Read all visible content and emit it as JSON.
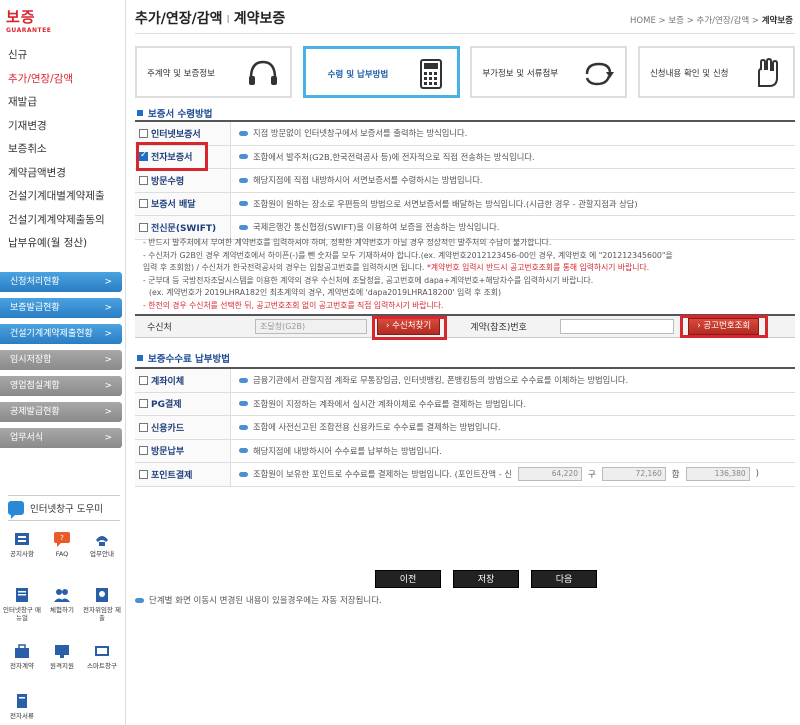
{
  "logo": {
    "title": "보증",
    "subtitle": "GUARANTEE"
  },
  "sidebar": {
    "menu": [
      "신규",
      "추가/연장/감액",
      "재발급",
      "기재변경",
      "보증취소",
      "계약금액변경",
      "건설기계대별계약제출",
      "건설기계계약제출동의",
      "납부유예(월 정산)"
    ],
    "active_index": 1,
    "section_buttons": [
      {
        "label": "신청처리현황",
        "arrow": ">",
        "style": "blue"
      },
      {
        "label": "보증발급현황",
        "arrow": ">",
        "style": "blue"
      },
      {
        "label": "건설기계계약제출현황",
        "arrow": ">",
        "style": "blue"
      },
      {
        "label": "임시저장함",
        "arrow": ">",
        "style": "gray"
      },
      {
        "label": "영업점실계함",
        "arrow": ">",
        "style": "gray"
      },
      {
        "label": "공제발급현황",
        "arrow": ">",
        "style": "gray"
      },
      {
        "label": "업무서식",
        "arrow": ">",
        "style": "gray"
      }
    ],
    "helper_title": "인터넷창구 도우미",
    "quick_links": [
      {
        "label": "공지사항",
        "icon": "notice-icon"
      },
      {
        "label": "FAQ",
        "icon": "faq-icon"
      },
      {
        "label": "업무안내",
        "icon": "phone-icon"
      },
      {
        "label": "인터넷창구 매뉴얼",
        "icon": "manual-icon"
      },
      {
        "label": "체험하기",
        "icon": "people-icon"
      },
      {
        "label": "전자위임장 제출",
        "icon": "document-icon"
      },
      {
        "label": "전자계약",
        "icon": "briefcase-icon"
      },
      {
        "label": "원격지원",
        "icon": "remote-icon"
      },
      {
        "label": "스마트창구",
        "icon": "smart-icon"
      },
      {
        "label": "전자서류",
        "icon": "paper-icon"
      }
    ]
  },
  "header": {
    "title_main": "추가/연장/감액",
    "title_sep": "I",
    "title_sub": "계약보증",
    "breadcrumb": [
      "HOME",
      ">",
      "보증",
      ">",
      "추가/연장/감액",
      ">",
      "계약보증"
    ]
  },
  "steps": [
    {
      "label": "주계약 및 보증정보",
      "icon": "headset-icon"
    },
    {
      "label": "수령 및 납부방법",
      "icon": "calculator-icon",
      "active": true
    },
    {
      "label": "부가정보 및 서류첨부",
      "icon": "rotate-icon"
    },
    {
      "label": "신청내용 확인 및 신청",
      "icon": "hand-icon"
    }
  ],
  "receipt_section": {
    "title": "보증서 수령방법",
    "options": [
      {
        "label": "인터넷보증서",
        "desc": "지점 방문없이 인터넷창구에서 보증서를 출력하는 방식입니다.",
        "checked": false
      },
      {
        "label": "전자보증서",
        "desc": "조합에서 발주처(G2B,한국전력공사 등)에 전자적으로 직접 전송하는 방식입니다.",
        "checked": true
      },
      {
        "label": "방문수령",
        "desc": "해당지점에 직접 내방하시어 서면보증서를 수령하시는 방법입니다.",
        "checked": false
      },
      {
        "label": "보증서 배달",
        "desc": "조합원이 원하는 장소로 우편등의 방법으로 서면보증서를 배달하는 방식입니다.(시급한 경우 - 관할지점과 상담)",
        "checked": false
      },
      {
        "label": "전신문(SWIFT)",
        "desc": "국제은행간 통신협정(SWIFT)을 이용하여 보증을 전송하는 방식입니다.",
        "checked": false
      }
    ]
  },
  "notes": {
    "line1": "- 반드시 발주처에서 부여한 계약번호를 입력하셔야 하며, 정확한 계약번호가 아닐 경우 정상적인 발주처의 수납이 불가합니다.",
    "line2": "- 수신처가 G2B인 경우 계약번호에서 하이픈(-)를 뺀 숫자를 모두 기재하셔야 합니다.(ex. 계약번호2012123456-00인 경우, 계약번호 에 \"201212345600\"을",
    "line3a": "입력 후 조회함) / 수신처가 한국전력공사의 경우는 입찰공고번호를 입력하시면 됩니다.",
    "line3b": "*계약번호 입력시 반드시 공고번호조회를 통해 입력하시기 바랍니다.",
    "line4": "- 군부대 등 국방전자조달시스템을 이용한 계약의 경우 수신처에 조달청을, 공고번호에 dapa+계약번호+해당차수를 입력하시기 바랍니다.",
    "line5": "(ex. 계약번호가 2019LHRA182인 최초계약의 경우, 계약번호에 'dapa2019LHRA18200' 입력 후 조회)",
    "line6": "- 한전의 경우 수신처를 선택한 뒤, 공고번호조회 없이 공고번호를 직접 입력하시기 바랍니다."
  },
  "receiver": {
    "label": "수신처",
    "value": "조달청(G2B)",
    "search_button": "수신처찾기",
    "contract_label": "계약(참조)번호",
    "contract_value": "",
    "lookup_button": "공고번호조회"
  },
  "payment_section": {
    "title": "보증수수료 납부방법",
    "options": [
      {
        "label": "계좌이체",
        "desc": "금융기관에서 관할지점 계좌로 무통장입금, 인터넷뱅킹, 폰뱅킹등의 방법으로 수수료를 이체하는 방법입니다."
      },
      {
        "label": "PG결제",
        "desc": "조합원이 지정하는 계좌에서 실시간 계좌이체로 수수료를 결제하는 방법입니다."
      },
      {
        "label": "신용카드",
        "desc": "조합에 사전신고된 조합전용 신용카드로 수수료를 결제하는 방법입니다."
      },
      {
        "label": "방문납부",
        "desc": "해당지점에 내방하시어 수수료를 납부하는 방법입니다."
      },
      {
        "label": "포인트결제",
        "desc": "조합원이 보유한 포인트로 수수료를 결제하는 방법입니다. (포인트잔액 - 신"
      }
    ],
    "points": {
      "new": "64,220",
      "old_label": "구",
      "old": "72,160",
      "sum_label": "합",
      "sum": "136,380",
      "close": ")"
    }
  },
  "buttons": {
    "prev": "이전",
    "save": "저장",
    "next": "다음"
  },
  "footnote": "단계별 화면 이동시 변경된 내용이 있을경우에는 자동 저장됩니다.",
  "colors": {
    "accent_red": "#d8262f",
    "highlight_blue": "#4ab2e3",
    "section_blue": "#1f4e96"
  }
}
